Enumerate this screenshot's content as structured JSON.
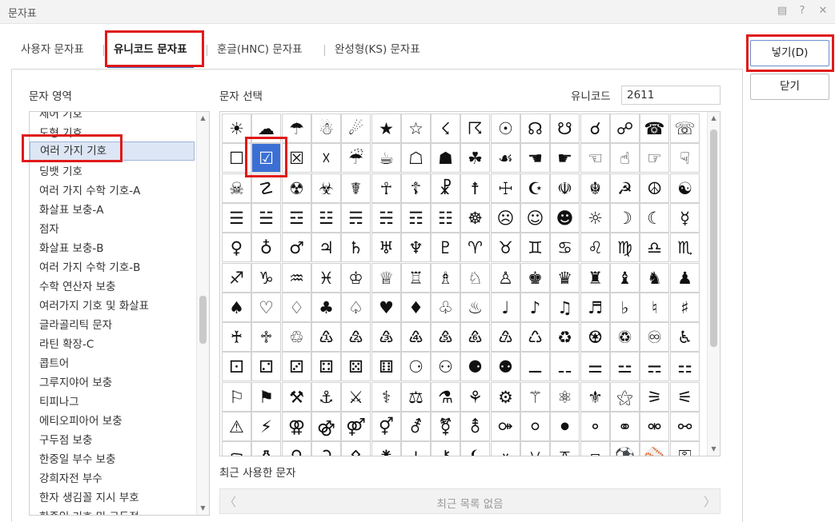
{
  "window": {
    "title": "문자표",
    "buttons": [
      "▤",
      "?",
      "✕"
    ]
  },
  "tabs": [
    {
      "label": "사용자 문자표"
    },
    {
      "label": "유니코드 문자표"
    },
    {
      "label": "훈글(HNC) 문자표"
    },
    {
      "label": "완성형(KS) 문자표"
    }
  ],
  "active_tab": "유니코드 문자표",
  "region": {
    "label": "문자 영역",
    "items": [
      "제어 기호",
      "도형 기호",
      "여러 가지 기호",
      "딩뱃 기호",
      "여러 가지 수학 기호-A",
      "화살표 보충-A",
      "점자",
      "화살표 보충-B",
      "여러 가지 수학 기호-B",
      "수학 연산자 보충",
      "여러가지 기호 및 화살표",
      "글라골리틱 문자",
      "라틴 확장-C",
      "콥트어",
      "그루지야어 보충",
      "티피나그",
      "에티오피아어 보충",
      "구두점 보충",
      "한중일 부수 보충",
      "강희자전 부수",
      "한자 생김꼴 지시 부호",
      "한중일 기호 및 구두점"
    ],
    "selected": "여러 가지 기호"
  },
  "chars": {
    "label": "문자 선택",
    "unicode_label": "유니코드",
    "unicode_value": "2611",
    "selected": "☑",
    "rows": [
      [
        "☀",
        "☁",
        "☂",
        "☃",
        "☄",
        "★",
        "☆",
        "☇",
        "☈",
        "☉",
        "☊",
        "☋",
        "☌",
        "☍",
        "☎",
        "☏"
      ],
      [
        "☐",
        "☑",
        "☒",
        "☓",
        "☔",
        "☕",
        "☖",
        "☗",
        "☘",
        "☙",
        "☚",
        "☛",
        "☜",
        "☝",
        "☞",
        "☟"
      ],
      [
        "☠",
        "☡",
        "☢",
        "☣",
        "☤",
        "☥",
        "☦",
        "☧",
        "☨",
        "☩",
        "☪",
        "☫",
        "☬",
        "☭",
        "☮",
        "☯"
      ],
      [
        "☰",
        "☱",
        "☲",
        "☳",
        "☴",
        "☵",
        "☶",
        "☷",
        "☸",
        "☹",
        "☺",
        "☻",
        "☼",
        "☽",
        "☾",
        "☿"
      ],
      [
        "♀",
        "♁",
        "♂",
        "♃",
        "♄",
        "♅",
        "♆",
        "♇",
        "♈",
        "♉",
        "♊",
        "♋",
        "♌",
        "♍",
        "♎",
        "♏"
      ],
      [
        "♐",
        "♑",
        "♒",
        "♓",
        "♔",
        "♕",
        "♖",
        "♗",
        "♘",
        "♙",
        "♚",
        "♛",
        "♜",
        "♝",
        "♞",
        "♟"
      ],
      [
        "♠",
        "♡",
        "♢",
        "♣",
        "♤",
        "♥",
        "♦",
        "♧",
        "♨",
        "♩",
        "♪",
        "♫",
        "♬",
        "♭",
        "♮",
        "♯"
      ],
      [
        "♰",
        "♱",
        "♲",
        "♳",
        "♴",
        "♵",
        "♶",
        "♷",
        "♸",
        "♹",
        "♺",
        "♻",
        "♼",
        "♽",
        "♾",
        "♿"
      ],
      [
        "⚀",
        "⚁",
        "⚂",
        "⚃",
        "⚄",
        "⚅",
        "⚆",
        "⚇",
        "⚈",
        "⚉",
        "⚊",
        "⚋",
        "⚌",
        "⚍",
        "⚎",
        "⚏"
      ],
      [
        "⚐",
        "⚑",
        "⚒",
        "⚓",
        "⚔",
        "⚕",
        "⚖",
        "⚗",
        "⚘",
        "⚙",
        "⚚",
        "⚛",
        "⚜",
        "⚝",
        "⚞",
        "⚟"
      ],
      [
        "⚠",
        "⚡",
        "⚢",
        "⚣",
        "⚤",
        "⚥",
        "⚦",
        "⚧",
        "⚨",
        "⚩",
        "⚪",
        "⚫",
        "⚬",
        "⚭",
        "⚮",
        "⚯"
      ],
      [
        "⚰",
        "⚱",
        "⚲",
        "⚳",
        "⚴",
        "⚵",
        "⚶",
        "⚷",
        "⚸",
        "⚹",
        "⚺",
        "⚻",
        "⚼",
        "⚽",
        "⚾",
        "⚿"
      ]
    ]
  },
  "recent": {
    "label": "최근 사용한 문자",
    "empty_text": "최근 목록 없음"
  },
  "buttons": {
    "insert": "넣기(D)",
    "close": "닫기"
  },
  "colors": {
    "accent": "#3b6fd4",
    "highlight": "#e01919",
    "selected_row_bg": "#dde6f4"
  }
}
